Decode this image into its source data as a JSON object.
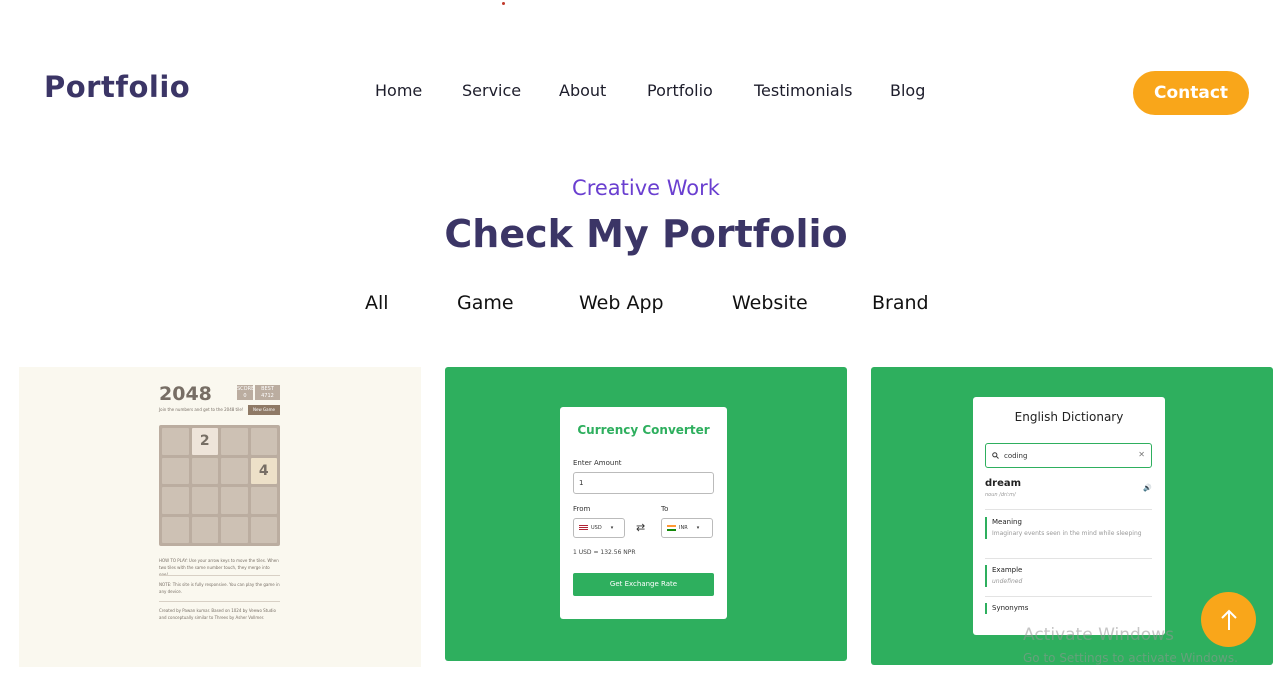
{
  "header": {
    "logo": "Portfolio",
    "nav": [
      "Home",
      "Service",
      "About",
      "Portfolio",
      "Testimonials",
      "Blog"
    ],
    "contact_label": "Contact"
  },
  "section": {
    "eyebrow": "Creative Work",
    "heading": "Check My Portfolio",
    "filters": [
      "All",
      "Game",
      "Web App",
      "Website",
      "Brand"
    ]
  },
  "colors": {
    "primary_dark": "#3b3566",
    "accent_purple": "#6a3fd0",
    "accent_orange": "#f9a61a",
    "card_green": "#2eaf5e"
  },
  "cards": {
    "game": {
      "title": "2048",
      "score_label": "SCORE",
      "score": "0",
      "best_label": "BEST",
      "best": "4712",
      "subtitle": "Join the numbers and get to the 2048 tile!",
      "new_game": "New Game",
      "tiles": [
        "",
        "2",
        "",
        "",
        "",
        "",
        "",
        "4",
        "",
        "",
        "",
        "",
        "",
        "",
        "",
        ""
      ],
      "how_to_play": "HOW TO PLAY: Use your arrow keys to move the tiles. When two tiles with the same number touch, they merge into one!",
      "note": "NOTE: This site is fully responsive. You can play the game in any device.",
      "credits": "Created by Pawan kumar. Based on 1024 by Veewo Studio and conceptually similar to Threes by Asher Vollmer."
    },
    "currency": {
      "title": "Currency Converter",
      "amount_label": "Enter Amount",
      "amount_value": "1",
      "from_label": "From",
      "to_label": "To",
      "from_currency": "USD",
      "to_currency": "INR",
      "swap_icon": "swap-arrows-icon",
      "rate_text": "1 USD = 132.56 NPR",
      "button": "Get Exchange Rate"
    },
    "dictionary": {
      "title": "English Dictionary",
      "search_value": "coding",
      "word": "dream",
      "phonetic": "noun /driːm/",
      "meaning_label": "Meaning",
      "meaning": "Imaginary events seen in the mind while sleeping",
      "example_label": "Example",
      "example": "undefined",
      "synonyms_label": "Synonyms"
    }
  },
  "watermark": {
    "line1": "Activate Windows",
    "line2": "Go to Settings to activate Windows."
  }
}
